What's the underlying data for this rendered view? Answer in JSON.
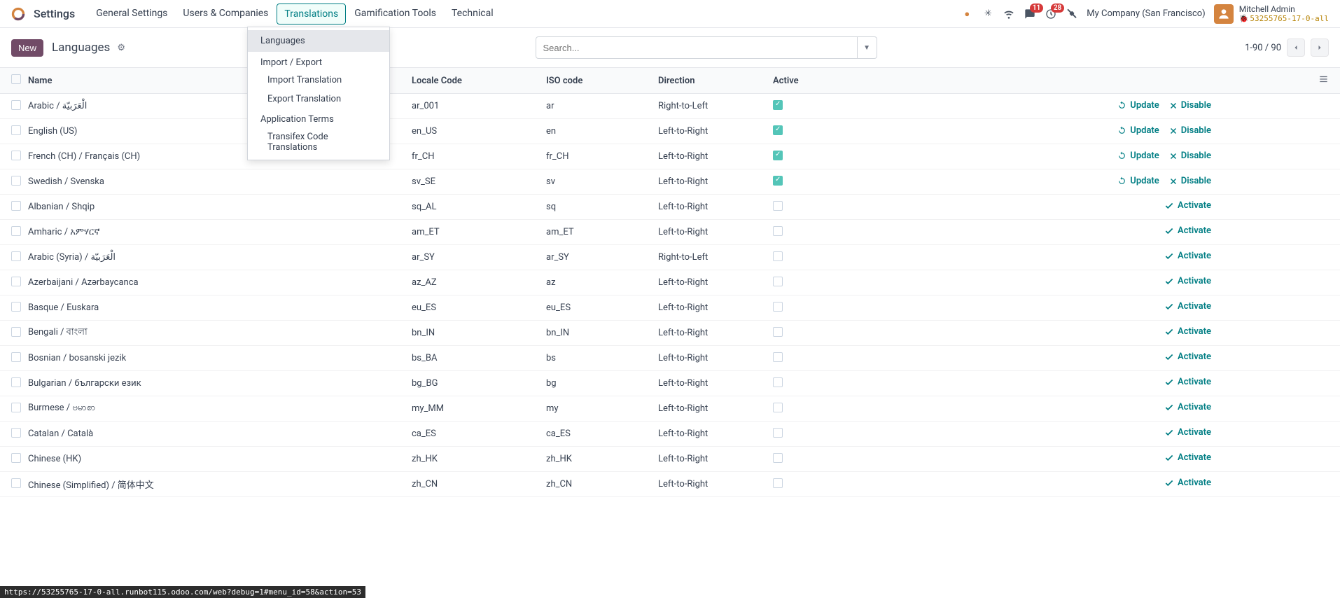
{
  "app": {
    "name": "Settings"
  },
  "nav": {
    "items": [
      {
        "label": "General Settings"
      },
      {
        "label": "Users & Companies"
      },
      {
        "label": "Translations",
        "active": true
      },
      {
        "label": "Gamification Tools"
      },
      {
        "label": "Technical"
      }
    ]
  },
  "topright": {
    "msg_badge": "11",
    "activity_badge": "28",
    "company": "My Company (San Francisco)",
    "user_name": "Mitchell Admin",
    "user_db": "53255765-17-0-all"
  },
  "control": {
    "new_btn": "New",
    "breadcrumb": "Languages",
    "search_placeholder": "Search...",
    "pager": "1-90 / 90"
  },
  "dropdown": {
    "languages": "Languages",
    "import_export": "Import / Export",
    "import_translation": "Import Translation",
    "export_translation": "Export Translation",
    "app_terms": "Application Terms",
    "transifex": "Transifex Code Translations"
  },
  "table": {
    "headers": {
      "name": "Name",
      "locale": "Locale Code",
      "iso": "ISO code",
      "dir": "Direction",
      "active": "Active"
    },
    "action_labels": {
      "update": "Update",
      "disable": "Disable",
      "activate": "Activate"
    },
    "rows": [
      {
        "name": "Arabic / الْعَرَبيّة",
        "locale": "ar_001",
        "iso": "ar",
        "dir": "Right-to-Left",
        "active": true
      },
      {
        "name": "English (US)",
        "locale": "en_US",
        "iso": "en",
        "dir": "Left-to-Right",
        "active": true
      },
      {
        "name": "French (CH) / Français (CH)",
        "locale": "fr_CH",
        "iso": "fr_CH",
        "dir": "Left-to-Right",
        "active": true
      },
      {
        "name": "Swedish / Svenska",
        "locale": "sv_SE",
        "iso": "sv",
        "dir": "Left-to-Right",
        "active": true
      },
      {
        "name": "Albanian / Shqip",
        "locale": "sq_AL",
        "iso": "sq",
        "dir": "Left-to-Right",
        "active": false
      },
      {
        "name": "Amharic / አምሃርኛ",
        "locale": "am_ET",
        "iso": "am_ET",
        "dir": "Left-to-Right",
        "active": false
      },
      {
        "name": "Arabic (Syria) / الْعَرَبيّة",
        "locale": "ar_SY",
        "iso": "ar_SY",
        "dir": "Right-to-Left",
        "active": false
      },
      {
        "name": "Azerbaijani / Azərbaycanca",
        "locale": "az_AZ",
        "iso": "az",
        "dir": "Left-to-Right",
        "active": false
      },
      {
        "name": "Basque / Euskara",
        "locale": "eu_ES",
        "iso": "eu_ES",
        "dir": "Left-to-Right",
        "active": false
      },
      {
        "name": "Bengali / বাংলা",
        "locale": "bn_IN",
        "iso": "bn_IN",
        "dir": "Left-to-Right",
        "active": false
      },
      {
        "name": "Bosnian / bosanski jezik",
        "locale": "bs_BA",
        "iso": "bs",
        "dir": "Left-to-Right",
        "active": false
      },
      {
        "name": "Bulgarian / български език",
        "locale": "bg_BG",
        "iso": "bg",
        "dir": "Left-to-Right",
        "active": false
      },
      {
        "name": "Burmese / ဗမာစာ",
        "locale": "my_MM",
        "iso": "my",
        "dir": "Left-to-Right",
        "active": false
      },
      {
        "name": "Catalan / Català",
        "locale": "ca_ES",
        "iso": "ca_ES",
        "dir": "Left-to-Right",
        "active": false
      },
      {
        "name": "Chinese (HK)",
        "locale": "zh_HK",
        "iso": "zh_HK",
        "dir": "Left-to-Right",
        "active": false
      },
      {
        "name": "Chinese (Simplified) / 简体中文",
        "locale": "zh_CN",
        "iso": "zh_CN",
        "dir": "Left-to-Right",
        "active": false
      }
    ]
  },
  "status_url": "https://53255765-17-0-all.runbot115.odoo.com/web?debug=1#menu_id=58&action=53"
}
